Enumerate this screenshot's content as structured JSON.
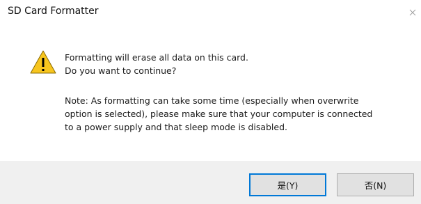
{
  "window": {
    "title": "SD Card Formatter",
    "close_icon": "close-icon"
  },
  "dialog": {
    "icon": "warning-icon",
    "icon_colors": {
      "fill": "#f7c51e",
      "stroke": "#8a6a00",
      "mark": "#000000"
    },
    "message_lines": [
      "Formatting will erase all data on this card.",
      "Do you want to continue?"
    ],
    "note_lines": [
      "Note: As formatting can take some time (especially when overwrite",
      "option is selected), please make sure that your computer is connected",
      "to a power supply and that sleep mode is disabled."
    ]
  },
  "buttons": {
    "yes_label": "是(Y)",
    "no_label": "否(N)",
    "focus_color": "#0078d7"
  }
}
